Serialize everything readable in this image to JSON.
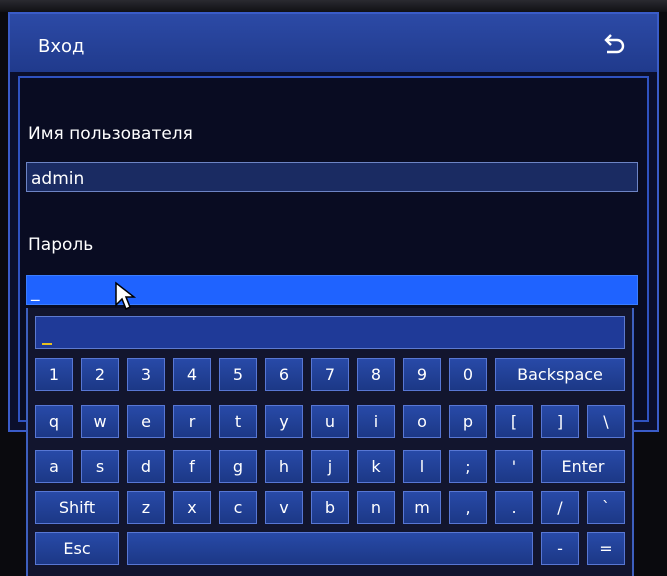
{
  "dialog": {
    "title": "Вход",
    "username_label": "Имя пользователя",
    "username_value": "admin",
    "password_label": "Пароль",
    "password_value": "_"
  },
  "keyboard": {
    "row1": [
      "1",
      "2",
      "3",
      "4",
      "5",
      "6",
      "7",
      "8",
      "9",
      "0",
      "Backspace"
    ],
    "row2": [
      "q",
      "w",
      "e",
      "r",
      "t",
      "y",
      "u",
      "i",
      "o",
      "p",
      "[",
      "]",
      "\\"
    ],
    "row3": [
      "a",
      "s",
      "d",
      "f",
      "g",
      "h",
      "j",
      "k",
      "l",
      ";",
      "'",
      "Enter"
    ],
    "row4": [
      "Shift",
      "z",
      "x",
      "c",
      "v",
      "b",
      "n",
      "m",
      ",",
      ".",
      "/",
      "`"
    ],
    "row5": [
      "Esc",
      "",
      "-",
      "="
    ]
  },
  "icons": {
    "back": "return-arrow-icon",
    "pointer": "mouse-pointer-icon"
  },
  "colors": {
    "titlebar": "#203a8c",
    "active_field": "#1f63ff",
    "key": "#284aa8"
  }
}
